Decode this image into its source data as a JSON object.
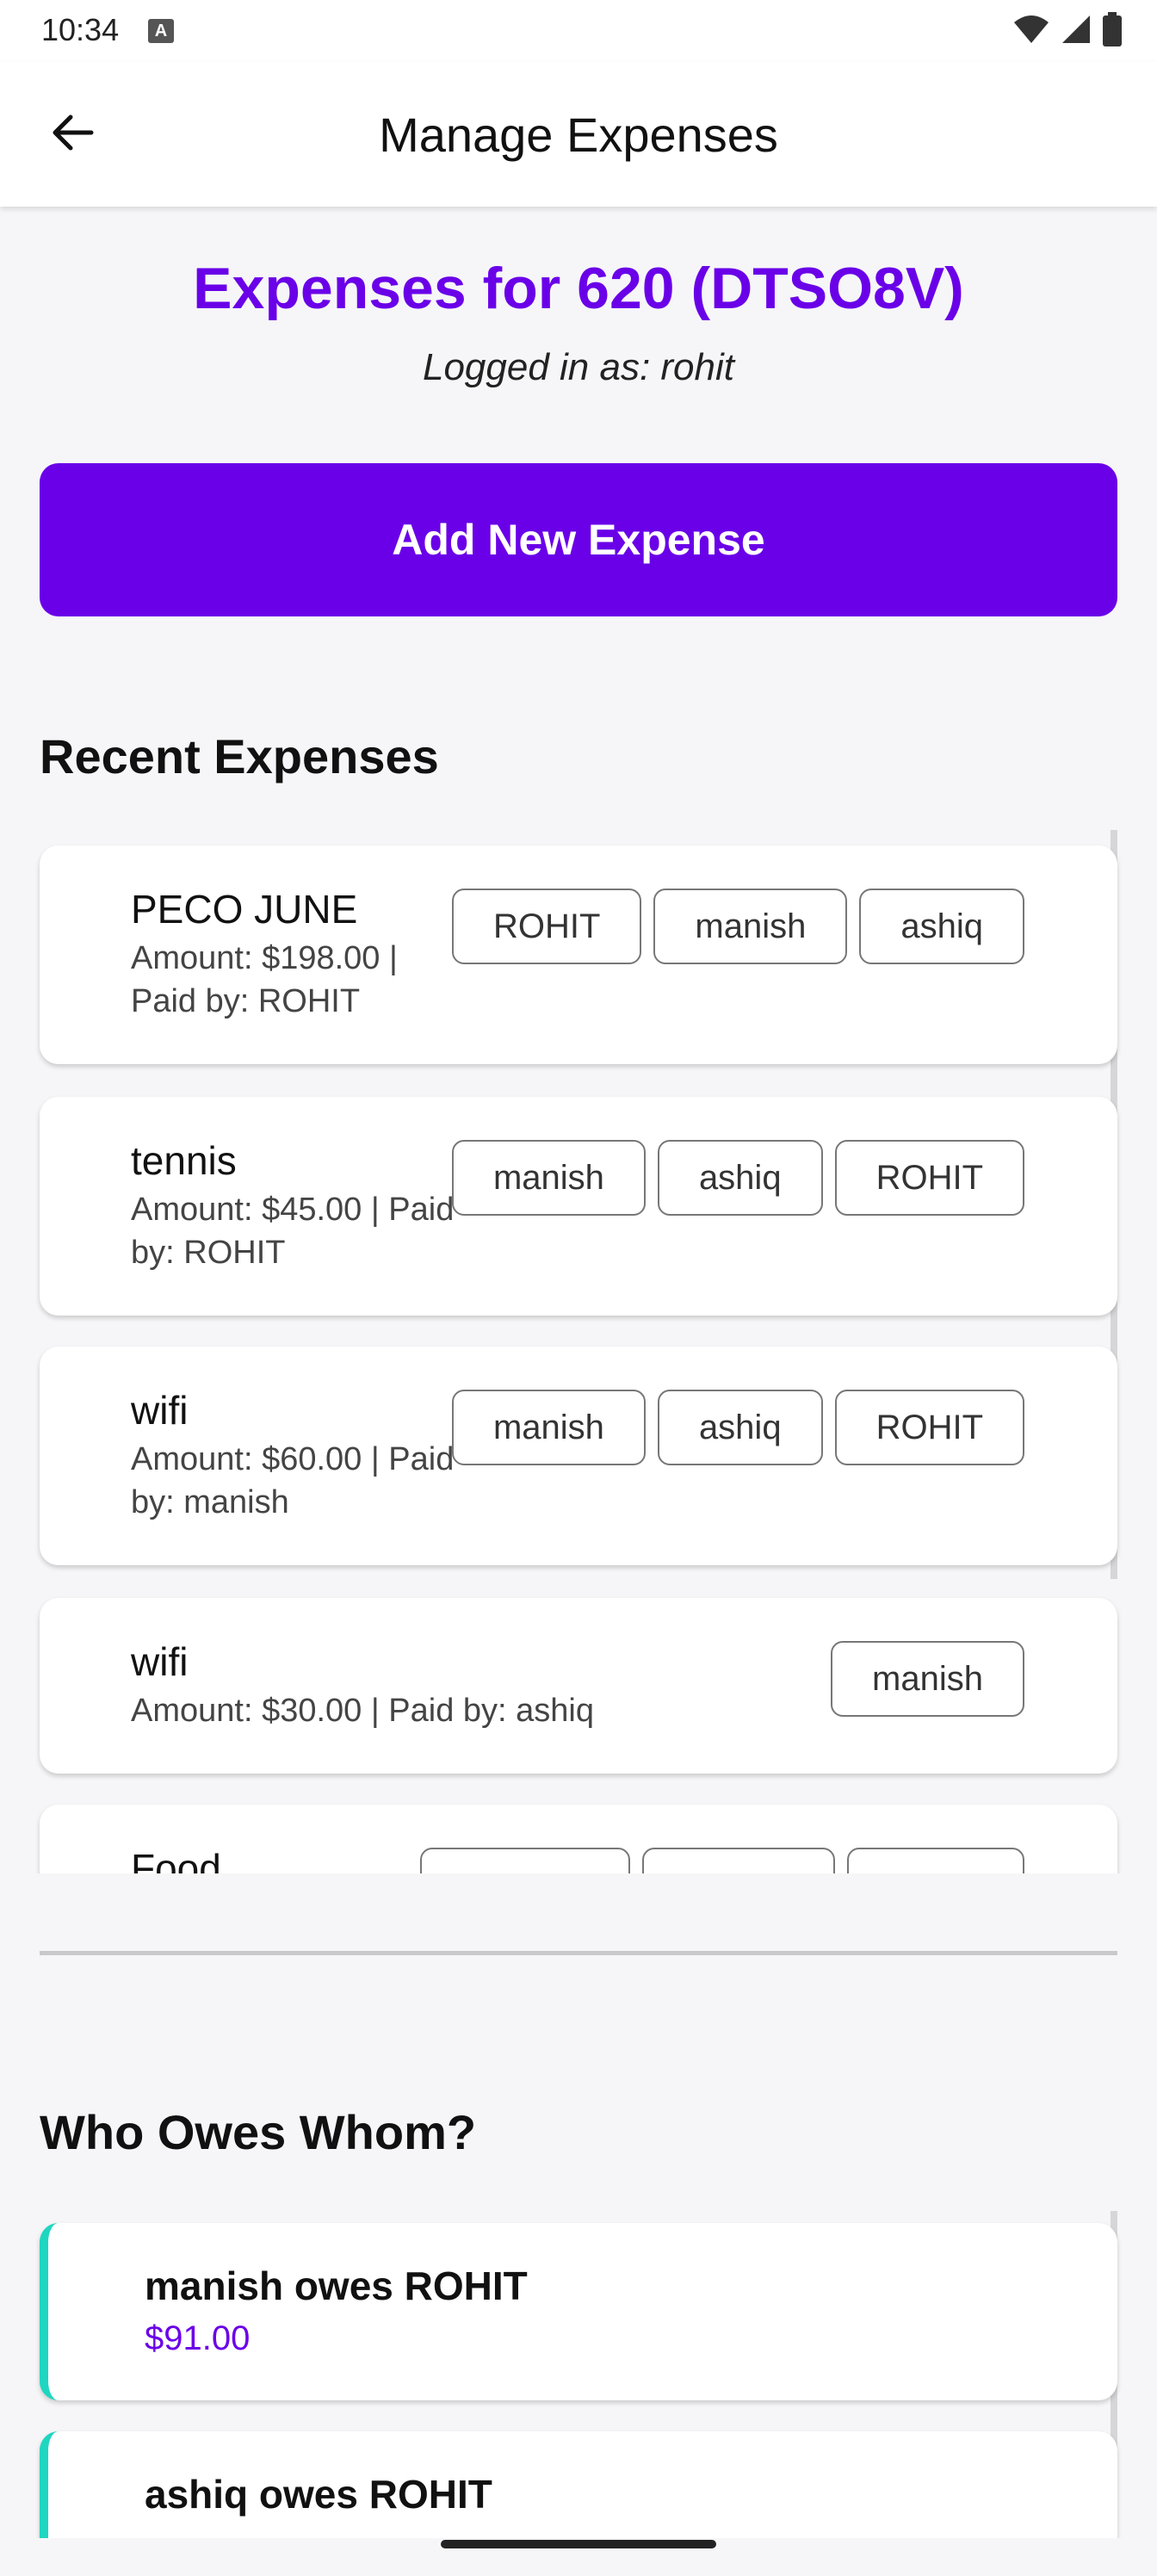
{
  "status_bar": {
    "time": "10:34",
    "badge": "A",
    "icons": [
      "wifi-icon",
      "signal-icon",
      "battery-icon"
    ]
  },
  "app_bar": {
    "title": "Manage Expenses",
    "back_icon": "arrow-left-icon"
  },
  "header": {
    "title": "Expenses for 620 (DTSO8V)",
    "logged_in": "Logged in as: rohit"
  },
  "add_button": {
    "label": "Add New Expense"
  },
  "recent": {
    "title": "Recent Expenses",
    "expenses": [
      {
        "name": "PECO JUNE",
        "details": "Amount: $198.00 | Paid by: ROHIT",
        "participants": [
          "ROHIT",
          "manish",
          "ashiq"
        ]
      },
      {
        "name": "tennis",
        "details": "Amount: $45.00 | Paid by: ROHIT",
        "participants": [
          "manish",
          "ashiq",
          "ROHIT"
        ]
      },
      {
        "name": "wifi",
        "details": "Amount: $60.00 | Paid by: manish",
        "participants": [
          "manish",
          "ashiq",
          "ROHIT"
        ]
      },
      {
        "name": "wifi",
        "details": "Amount: $30.00 | Paid by: ashiq",
        "participants": [
          "manish"
        ]
      },
      {
        "name": "Food",
        "details": "",
        "participants": [
          "",
          "",
          ""
        ]
      }
    ]
  },
  "owes": {
    "title": "Who Owes Whom?",
    "items": [
      {
        "text": "manish owes ROHIT",
        "amount": "$91.00"
      },
      {
        "text": "ashiq owes ROHIT",
        "amount": ""
      }
    ]
  },
  "colors": {
    "accent": "#6a00e8",
    "teal": "#1fd6c0",
    "background": "#f6f6f8"
  }
}
